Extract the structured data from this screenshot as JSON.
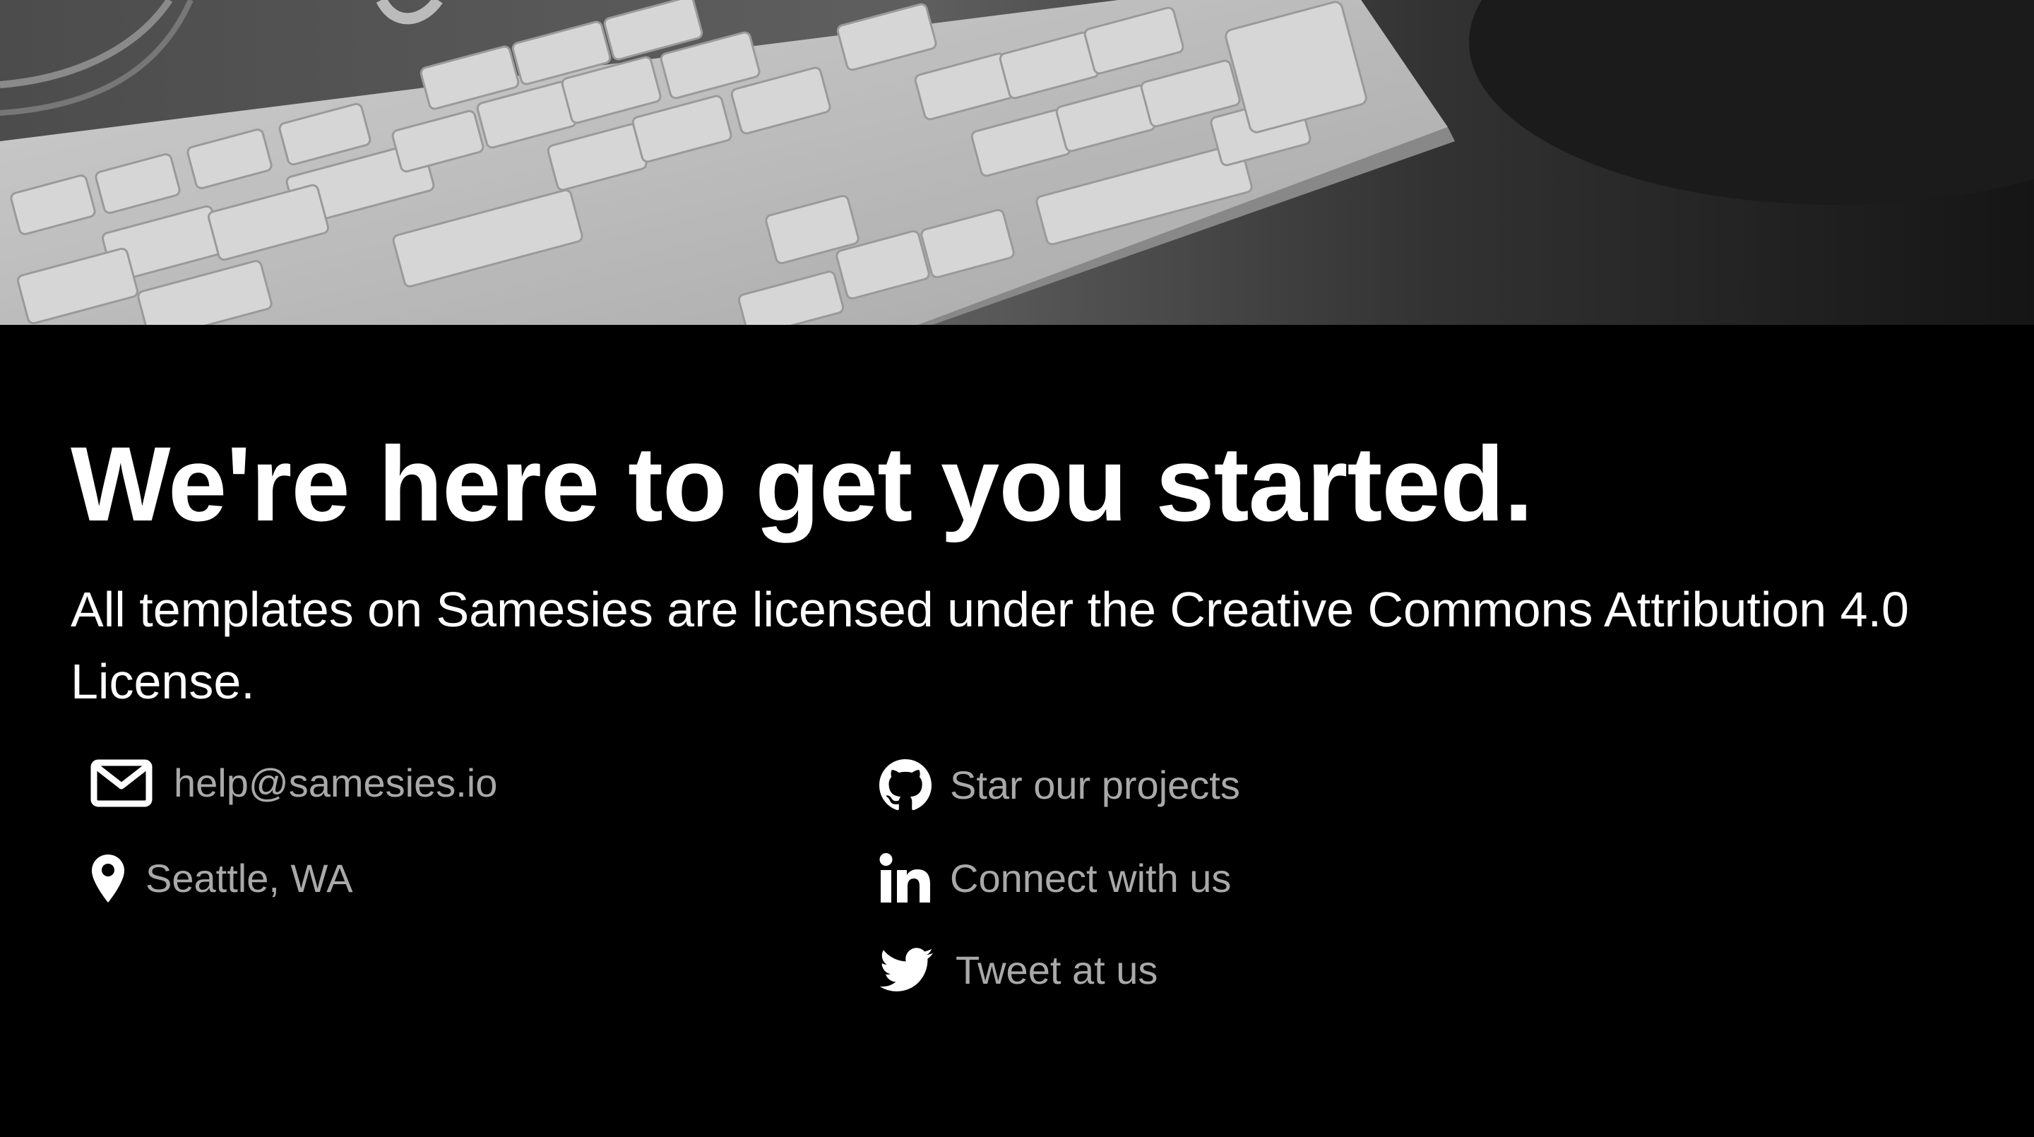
{
  "hero": {
    "image_icon": "keyboard-photo"
  },
  "main": {
    "headline": "We're here to get you started.",
    "subtext": "All templates on Samesies are licensed under the Creative Commons Attribution 4.0 License."
  },
  "contact": {
    "email": {
      "icon": "envelope-icon",
      "label": "help@samesies.io"
    },
    "location": {
      "icon": "map-pin-icon",
      "label": "Seattle, WA"
    }
  },
  "social": {
    "github": {
      "icon": "github-icon",
      "label": "Star our projects"
    },
    "linkedin": {
      "icon": "linkedin-icon",
      "label": "Connect with us"
    },
    "twitter": {
      "icon": "twitter-icon",
      "label": "Tweet at us"
    }
  },
  "colors": {
    "background": "#000000",
    "heading": "#ffffff",
    "link": "#a9a9a9",
    "icon": "#ffffff"
  }
}
